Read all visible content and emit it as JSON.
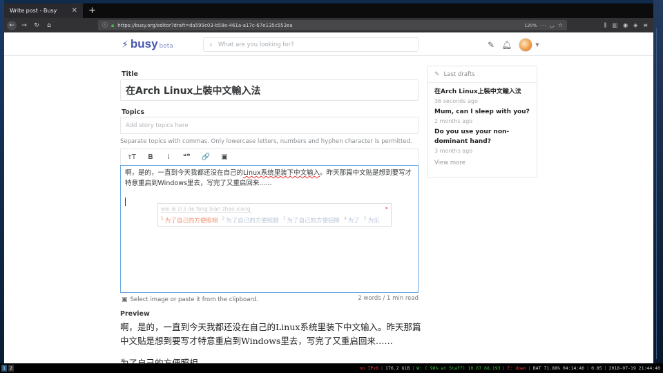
{
  "browser": {
    "tab_title": "Write post - Busy",
    "tab_close": "✕",
    "new_tab": "+",
    "url": "https://busy.org/editor?draft=da599c03-b58e-461a-a17c-67e135c553ea",
    "zoom": "120%"
  },
  "header": {
    "logo_text": "busy",
    "logo_badge": "beta",
    "search_placeholder": "What are you looking for?"
  },
  "editor": {
    "title_label": "Title",
    "title_value": "在Arch Linux上裝中文輸入法",
    "topics_label": "Topics",
    "topics_placeholder": "Add story topics here",
    "topics_help": "Separate topics with commas. Only lowercase letters, numbers and hyphen character is permitted.",
    "toolbar": {
      "heading": "тT",
      "bold": "B",
      "italic": "i",
      "quote": "❝❞",
      "link": "🔗",
      "image": "▣"
    },
    "body_line1_a": "啊，是的，一直到今天我都还没在自己的",
    "body_line1_b": "Linux系统里装下中文输入",
    "body_line1_c": "。昨天那篇中文贴是想到要写才",
    "body_line2": "特意重启到Windows里去，写完了又重启回来......",
    "image_hint": "Select image or paste it from the clipboard.",
    "word_count": "2 words / 1 min read"
  },
  "ime": {
    "pinyin": "wei le zi ji de fang bian zhao xiang",
    "candidates": [
      {
        "num": "1",
        "text": "为了自己的方便照相"
      },
      {
        "num": "2",
        "text": "为了自己的方便照顾"
      },
      {
        "num": "3",
        "text": "为了自己的方便招降"
      },
      {
        "num": "4",
        "text": "为了"
      },
      {
        "num": "5",
        "text": "为乐"
      }
    ]
  },
  "preview": {
    "label": "Preview",
    "text": "啊，是的，一直到今天我都还没在自己的Linux系统里装下中文输入。昨天那篇中文贴是想到要写才特意重启到Windows里去，写完了又重启回来……",
    "extra": "为了自己的方便照相"
  },
  "drafts": {
    "heading": "Last drafts",
    "items": [
      {
        "title": "在Arch Linux上裝中文輸入法",
        "time": "36 seconds ago"
      },
      {
        "title": "Mum, can I sleep with you?",
        "time": "2 months ago"
      },
      {
        "title": "Do you use your non-dominant hand?",
        "time": "3 months ago"
      }
    ],
    "view_more": "View more"
  },
  "taskbar": {
    "workspaces": [
      "1",
      "2"
    ],
    "ipv6": "no IPv6",
    "disk": "176.2 GiB",
    "wifi": "W: ( 98% at Staff) 10.67.68.193",
    "eth": "E: down",
    "battery": "BAT 71.88% 04:14:46",
    "load": "0.85",
    "datetime": "2018-07-19 21:44:40"
  }
}
